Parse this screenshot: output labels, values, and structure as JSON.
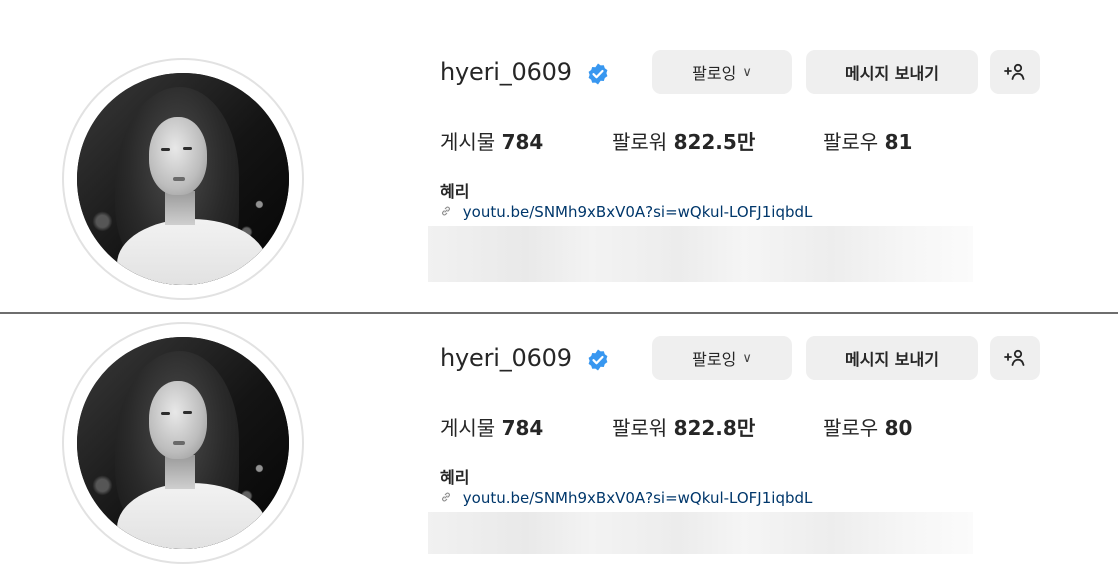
{
  "profiles": [
    {
      "username": "hyeri_0609",
      "follow_label": "팔로잉",
      "follow_chevron": "∨",
      "message_label": "메시지 보내기",
      "add_person_label": "+ጵ",
      "posts_label": "게시물",
      "posts_count": "784",
      "followers_label": "팔로워",
      "followers_count": "822.5만",
      "following_label": "팔로우",
      "following_count": "81",
      "display_name": "혜리",
      "link": "youtu.be/SNMh9xBxV0A?si=wQkul-LOFJ1iqbdL"
    },
    {
      "username": "hyeri_0609",
      "follow_label": "팔로잉",
      "follow_chevron": "∨",
      "message_label": "메시지 보내기",
      "add_person_label": "+ጵ",
      "posts_label": "게시물",
      "posts_count": "784",
      "followers_label": "팔로워",
      "followers_count": "822.8만",
      "following_label": "팔로우",
      "following_count": "80",
      "display_name": "혜리",
      "link": "youtu.be/SNMh9xBxV0A?si=wQkul-LOFJ1iqbdL"
    }
  ],
  "icons": {
    "verified": "verified-badge-icon",
    "link": "link-chain-icon",
    "chevron": "chevron-down-icon",
    "add_person": "add-person-icon"
  },
  "colors": {
    "verified_blue": "#3897f0",
    "button_bg": "#efefef",
    "link_text": "#00376b",
    "divider": "#6e6e6e"
  }
}
